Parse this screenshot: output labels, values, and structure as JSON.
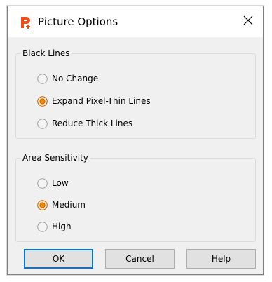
{
  "window": {
    "title": "Picture Options",
    "app_icon": "fill-brush-app-icon",
    "close_icon": "close-icon"
  },
  "groups": [
    {
      "legend": "Black Lines",
      "options": [
        {
          "label": "No Change",
          "selected": false
        },
        {
          "label": "Expand Pixel-Thin Lines",
          "selected": true
        },
        {
          "label": "Reduce Thick Lines",
          "selected": false
        }
      ]
    },
    {
      "legend": "Area Sensitivity",
      "options": [
        {
          "label": "Low",
          "selected": false
        },
        {
          "label": "Medium",
          "selected": true
        },
        {
          "label": "High",
          "selected": false
        }
      ]
    }
  ],
  "buttons": {
    "ok": "OK",
    "cancel": "Cancel",
    "help": "Help"
  },
  "colors": {
    "accent": "#e85c1a",
    "radio_selected": "#f08a00"
  }
}
